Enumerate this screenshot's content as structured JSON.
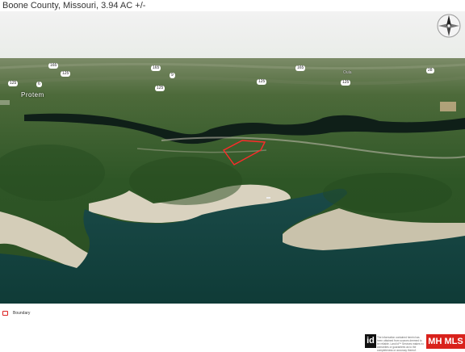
{
  "header": {
    "title": "Boone County, Missouri, 3.94 AC +/-"
  },
  "map": {
    "road_labels": [
      {
        "name": "label-165-a",
        "text": "165"
      },
      {
        "name": "label-125-a",
        "text": "125"
      },
      {
        "name": "label-125-b",
        "text": "125"
      },
      {
        "name": "label-6",
        "text": "6"
      },
      {
        "name": "label-165-b",
        "text": "165"
      },
      {
        "name": "label-9",
        "text": "9"
      },
      {
        "name": "label-125-c",
        "text": "125"
      },
      {
        "name": "label-125-d",
        "text": "125"
      },
      {
        "name": "label-165-c",
        "text": "165"
      },
      {
        "name": "label-125-e",
        "text": "125"
      },
      {
        "name": "label-28",
        "text": "28"
      }
    ],
    "town_label": "Protem",
    "small_place_label": "Oula",
    "colors": {
      "boundary": "#ff2a2a",
      "water": "#123d3a",
      "forest": "#2f5a2a"
    }
  },
  "legend": {
    "label": "Boundary"
  },
  "footer": {
    "logo_text": "id",
    "disclaimer": "The information contained herein has been obtained from sources deemed to be reliable. Land id™ Services makes no warranties or guarantees as to the completeness or accuracy thereof.",
    "mls_badge": "MH MLS"
  }
}
